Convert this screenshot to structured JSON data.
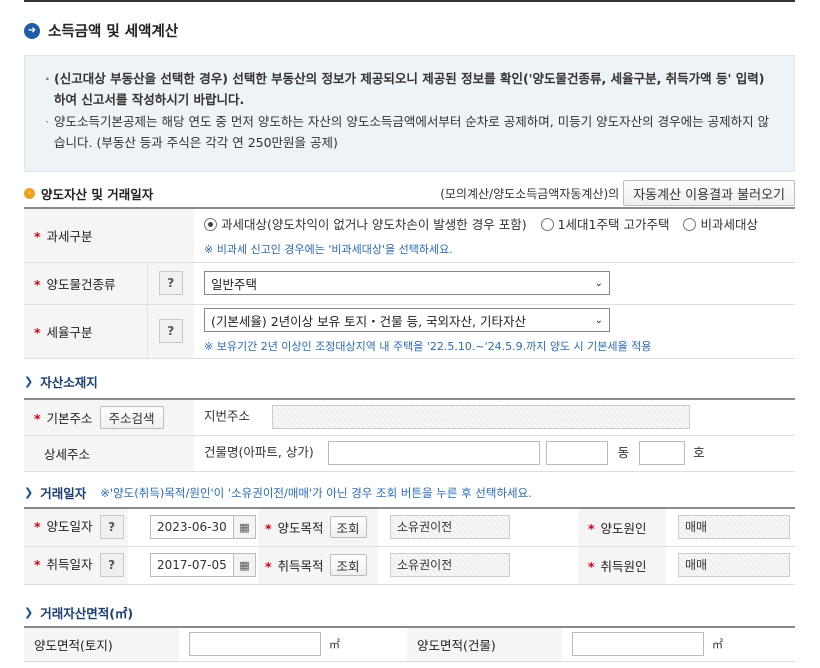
{
  "header": {
    "title": "소득금액 및 세액계산"
  },
  "notice": {
    "lines": [
      "(신고대상 부동산을 선택한 경우) 선택한 부동산의 정보가 제공되오니 제공된 정보를 확인('양도물건종류, 세율구분, 취득가액 등' 입력)하여 신고서를 작성하시기 바랍니다.",
      "양도소득기본공제는 해당 연도 중 먼저 양도하는 자산의 양도소득금액에서부터 순차로 공제하며, 미등기 양도자산의 경우에는 공제하지 않습니다. (부동산 등과 주식은 각각 연 250만원을 공제)"
    ]
  },
  "asset_section": {
    "title": "양도자산 및 거래일자",
    "note": "(모의계산/양도소득금액자동계산)의",
    "load_button": "자동계산 이용결과 불러오기"
  },
  "form": {
    "tax_class": {
      "label": "과세구분",
      "options": [
        "과세대상(양도차익이 없거나 양도차손이 발생한 경우 포함)",
        "1세대1주택 고가주택",
        "비과세대상"
      ],
      "selected": 0,
      "hint": "※ 비과세 신고인 경우에는 '비과세대상'을 선택하세요."
    },
    "property_type": {
      "label": "양도물건종류",
      "help": "?",
      "value": "일반주택"
    },
    "tax_rate": {
      "label": "세율구분",
      "help": "?",
      "value": "(기본세율) 2년이상 보유 토지・건물 등, 국외자산, 기타자산",
      "hint": "※ 보유기간 2년 이상인 조정대상지역 내 주택을 '22.5.10.~'24.5.9.까지 양도 시 기본세율 적용"
    }
  },
  "location": {
    "title": "자산소재지",
    "basic_address_label": "기본주소",
    "search_button": "주소검색",
    "lot_address_label": "지번주소",
    "detail_address_label": "상세주소",
    "building_label": "건물명(아파트, 상가)",
    "dong": "동",
    "ho": "호"
  },
  "trade_date": {
    "title": "거래일자",
    "note": "※'양도(취득)목적/원인'이 '소유권이전/매매'가 아닌 경우 조회 버튼을 누른 후 선택하세요.",
    "rows": [
      {
        "date_label": "양도일자",
        "help": "?",
        "date": "2023-06-30",
        "purpose_label": "양도목적",
        "lookup_button": "조회",
        "purpose_value": "소유권이전",
        "cause_label": "양도원인",
        "cause_value": "매매"
      },
      {
        "date_label": "취득일자",
        "help": "?",
        "date": "2017-07-05",
        "purpose_label": "취득목적",
        "lookup_button": "조회",
        "purpose_value": "소유권이전",
        "cause_label": "취득원인",
        "cause_value": "매매"
      }
    ]
  },
  "area": {
    "title": "거래자산면적(㎡)",
    "land_label": "양도면적(토지)",
    "building_label": "양도면적(건물)",
    "unit": "㎡"
  },
  "colors": {
    "required_star": "#d0021b",
    "hint_blue": "#2a6bb5",
    "heading_navy": "#1a3e72",
    "notice_bg": "#eef3f8",
    "label_bg": "#f5f5f5"
  }
}
